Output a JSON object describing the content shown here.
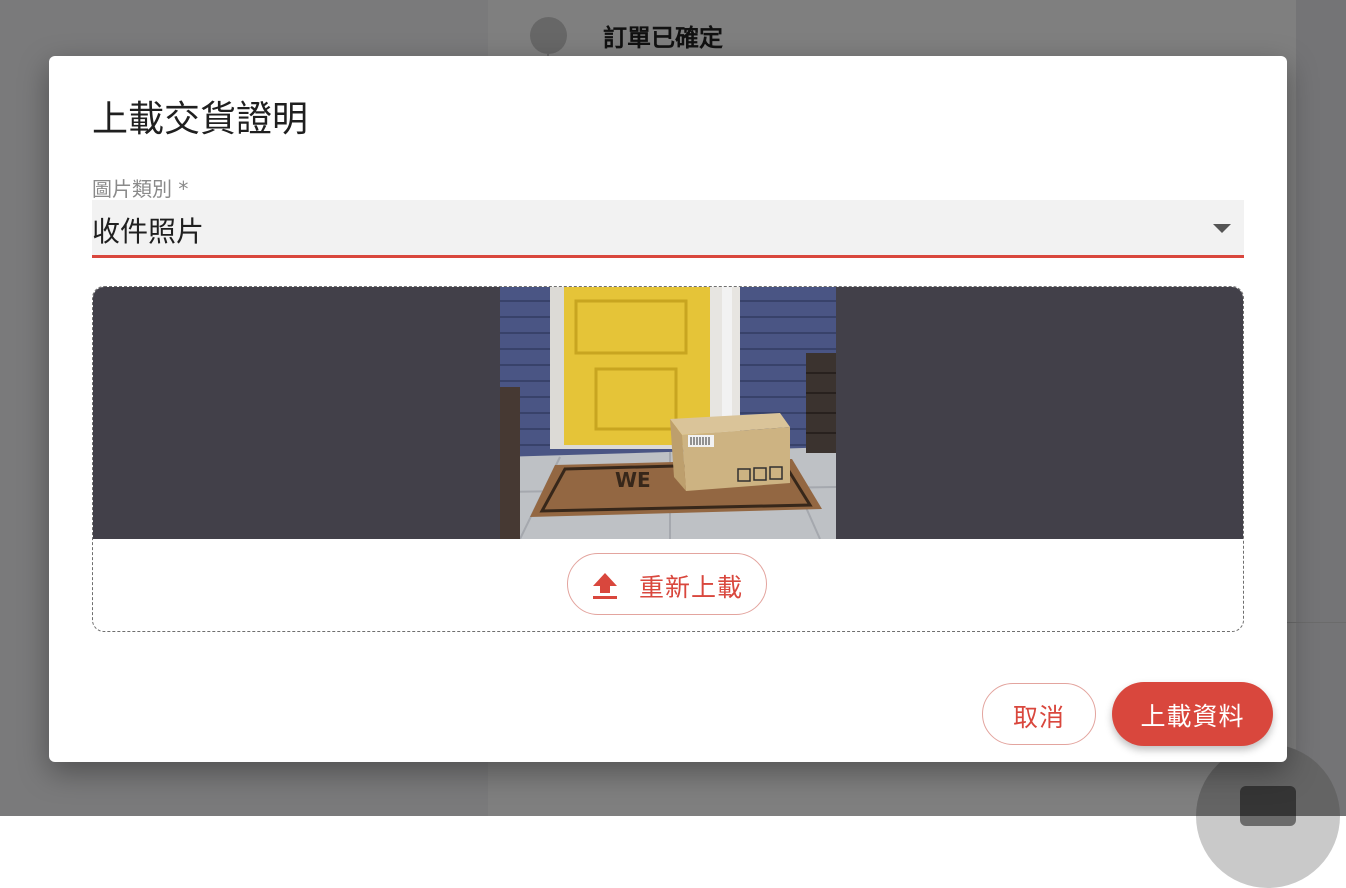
{
  "background": {
    "status_text": "訂單已確定"
  },
  "dialog": {
    "title": "上載交貨證明",
    "category_field": {
      "label": "圖片類別 *",
      "value": "收件照片"
    },
    "upload": {
      "preview_alt": "package-at-door-photo",
      "reupload_label": "重新上載",
      "reupload_icon": "upload-icon"
    },
    "actions": {
      "cancel_label": "取消",
      "submit_label": "上載資料"
    }
  },
  "colors": {
    "accent": "#d9473d",
    "accent_border": "#e3a49e",
    "preview_bg": "#424049"
  }
}
